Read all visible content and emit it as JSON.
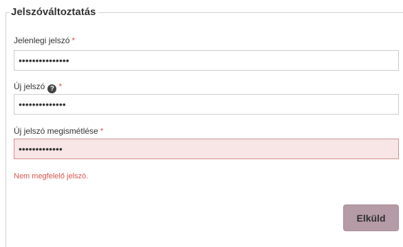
{
  "form": {
    "legend": "Jelszóváltoztatás",
    "required_marker": "*",
    "current_password": {
      "label": "Jelenlegi jelszó",
      "value": "•••••••••••••••"
    },
    "new_password": {
      "label": "Új jelszó",
      "help_icon": "?",
      "value": "••••••••••••••"
    },
    "confirm_password": {
      "label": "Új jelszó megismétlése",
      "value": "•••••••••••••"
    },
    "error_message": "Nem megfelelő jelszó.",
    "submit_label": "Elküld"
  },
  "icons": {
    "help": "question-circle-icon"
  },
  "colors": {
    "required": "#d9534f",
    "error_text": "#d9534f",
    "error_field_bg": "#f8e5e5",
    "button_bg": "#b59ba6"
  }
}
